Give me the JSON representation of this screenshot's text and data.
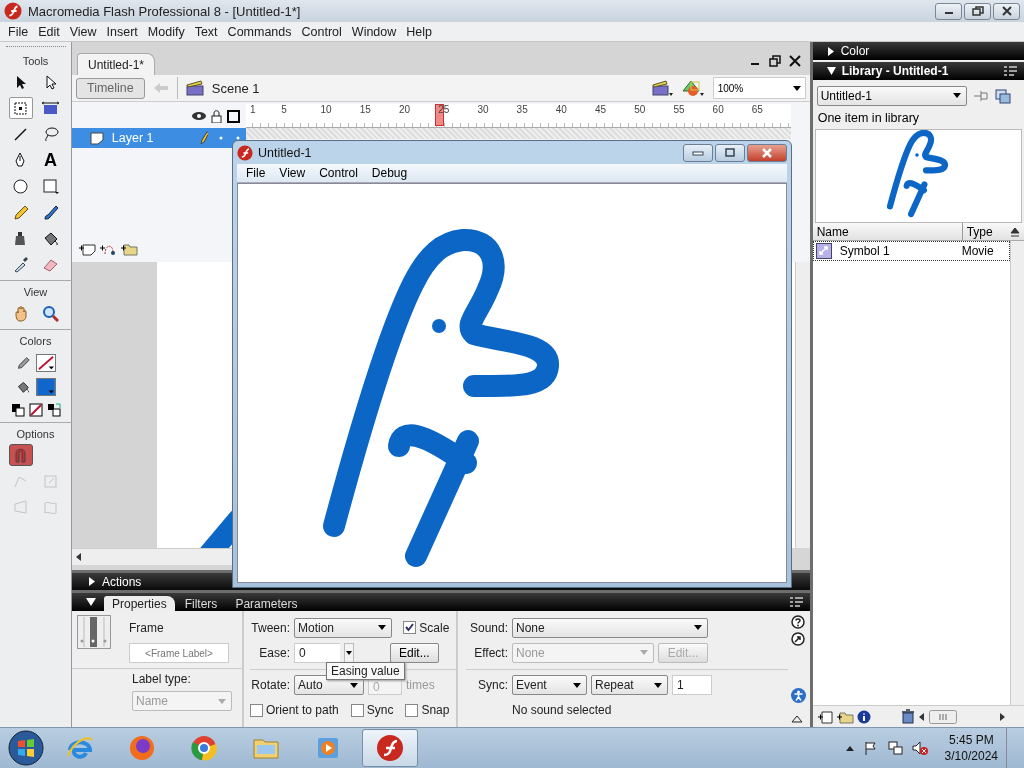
{
  "window": {
    "title": "Macromedia Flash Professional 8 - [Untitled-1*]"
  },
  "menu": [
    "File",
    "Edit",
    "View",
    "Insert",
    "Modify",
    "Text",
    "Commands",
    "Control",
    "Window",
    "Help"
  ],
  "tools": {
    "title": "Tools",
    "items": [
      {
        "kind": "arrow",
        "selected": false
      },
      {
        "kind": "subselect",
        "selected": false
      },
      {
        "kind": "transform",
        "selected": true
      },
      {
        "kind": "gradient",
        "selected": false
      },
      {
        "kind": "line",
        "selected": false
      },
      {
        "kind": "lasso",
        "selected": false
      },
      {
        "kind": "pen",
        "selected": false
      },
      {
        "kind": "text",
        "glyph": "A",
        "selected": false
      },
      {
        "kind": "oval",
        "selected": false
      },
      {
        "kind": "rect",
        "selected": false
      },
      {
        "kind": "pencil",
        "selected": false
      },
      {
        "kind": "brush",
        "selected": false
      },
      {
        "kind": "ink",
        "selected": false
      },
      {
        "kind": "bucket",
        "selected": false
      },
      {
        "kind": "dropper",
        "selected": false
      },
      {
        "kind": "eraser",
        "selected": false
      }
    ],
    "view_label": "View",
    "view_items": [
      {
        "kind": "hand",
        "selected": false
      },
      {
        "kind": "zoom",
        "selected": false
      }
    ],
    "colors_label": "Colors",
    "colors": [
      {
        "kind": "stroke",
        "no_color": true
      },
      {
        "kind": "fill",
        "no_color": false,
        "color": "#1166cc"
      }
    ],
    "options_label": "Options",
    "options": [
      {
        "kind": "snap",
        "on": true,
        "disabled": false
      },
      {
        "kind": "smooth",
        "on": false,
        "disabled": true
      },
      {
        "kind": "scale",
        "on": false,
        "disabled": true
      },
      {
        "kind": "distort",
        "on": false,
        "disabled": true
      },
      {
        "kind": "envelope",
        "on": false,
        "disabled": true
      }
    ]
  },
  "document": {
    "tab": "Untitled-1*",
    "timeline_button": "Timeline",
    "scene": "Scene 1",
    "zoom": "100%"
  },
  "timeline": {
    "ruler": [
      "1",
      "5",
      "10",
      "15",
      "20",
      "25",
      "30",
      "35",
      "40",
      "45",
      "50",
      "55",
      "60",
      "65"
    ],
    "playhead": {
      "level": 0.355
    },
    "layers": [
      {
        "name": "Layer 1",
        "selected": true
      }
    ]
  },
  "actions_panel": {
    "title": "Actions",
    "expanded": false
  },
  "properties": {
    "tabs": [
      {
        "label": "Properties",
        "selected": true
      },
      {
        "label": "Filters",
        "selected": false
      },
      {
        "label": "Parameters",
        "selected": false
      }
    ],
    "frame_title": "Frame",
    "frame_label_placeholder": "<Frame Label>",
    "label_type_label": "Label type:",
    "label_type": {
      "value": "Name",
      "disabled": true
    },
    "tween_label": "Tween:",
    "tween": "Motion",
    "scale": {
      "label": "Scale",
      "checked": true
    },
    "ease_label": "Ease:",
    "ease": "0",
    "ease_edit": "Edit...",
    "tooltip": "Easing value",
    "rotate_label": "Rotate:",
    "rotate": "Auto",
    "times": {
      "value": "0",
      "disabled": true
    },
    "times_label": "times",
    "checks": [
      {
        "label": "Orient to path",
        "checked": false
      },
      {
        "label": "Sync",
        "checked": false
      },
      {
        "label": "Snap",
        "checked": false
      }
    ],
    "sound_label": "Sound:",
    "sound": "None",
    "effect_label": "Effect:",
    "effect": {
      "value": "None",
      "disabled": true
    },
    "effect_edit": {
      "label": "Edit...",
      "disabled": true
    },
    "sync_label": "Sync:",
    "sync": "Event",
    "repeat": "Repeat",
    "repeat_count": "1",
    "sound_status": "No sound selected"
  },
  "color_panel": {
    "title": "Color",
    "expanded": false
  },
  "library": {
    "title": "Library - Untitled-1",
    "expanded": true,
    "document": "Untitled-1",
    "count": "One item in library",
    "columns": [
      "Name",
      "Type"
    ],
    "items": [
      {
        "name": "Symbol 1",
        "type": "Movie",
        "selected": false
      }
    ]
  },
  "player": {
    "title": "Untitled-1",
    "menu": [
      "File",
      "View",
      "Control",
      "Debug"
    ]
  },
  "taskbar": {
    "apps": [
      {
        "kind": "ie",
        "selected": false
      },
      {
        "kind": "firefox",
        "selected": false
      },
      {
        "kind": "chrome",
        "selected": false
      },
      {
        "kind": "explorer",
        "selected": false
      },
      {
        "kind": "media",
        "selected": false
      },
      {
        "kind": "flash",
        "selected": true
      }
    ],
    "time": "5:45 PM",
    "date": "3/10/2024"
  }
}
